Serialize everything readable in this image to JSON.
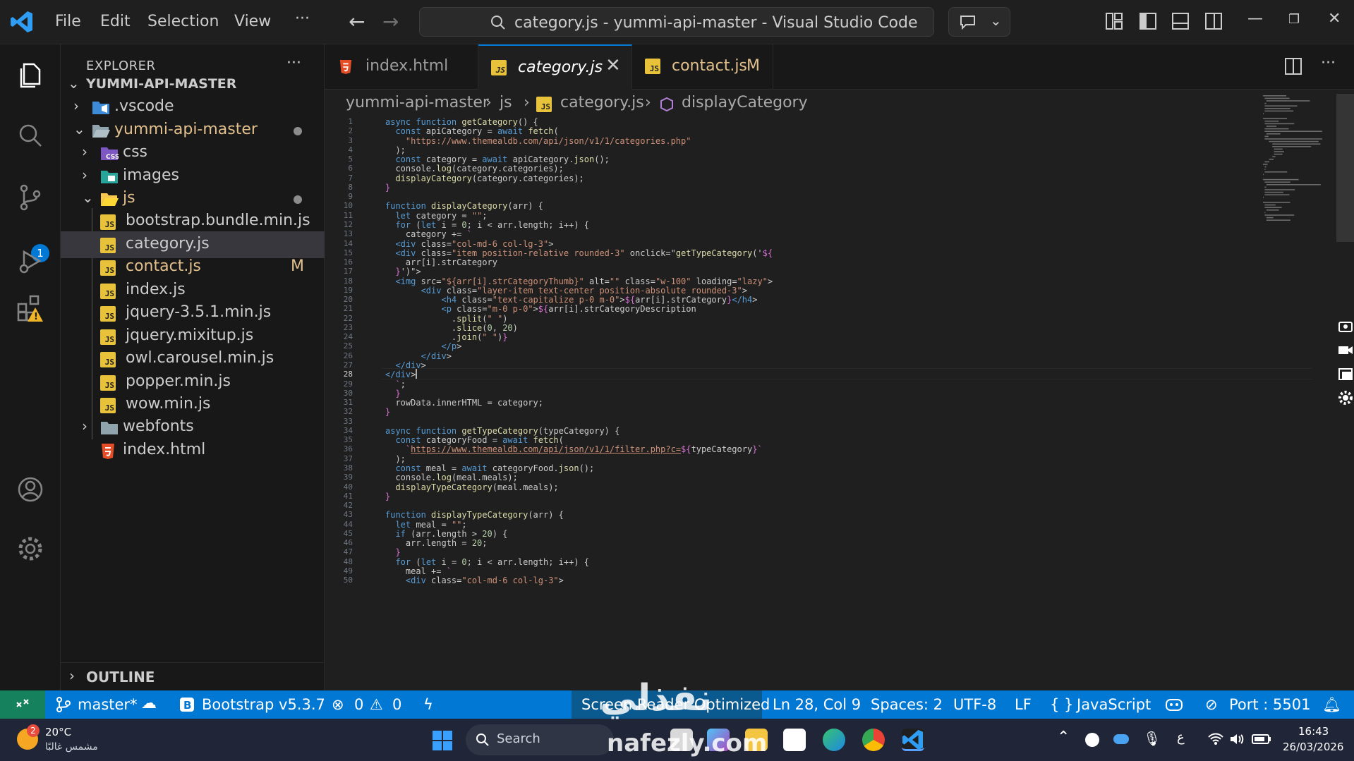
{
  "titlebar": {
    "menu": [
      "File",
      "Edit",
      "Selection",
      "View",
      "···"
    ],
    "title": "category.js - yummi-api-master - Visual Studio Code"
  },
  "explorer": {
    "header": "EXPLORER",
    "more": "···",
    "root": "YUMMI-API-MASTER",
    "items": [
      {
        "label": ".vscode"
      },
      {
        "label": "yummi-api-master"
      },
      {
        "label": "css"
      },
      {
        "label": "images"
      },
      {
        "label": "js"
      },
      {
        "label": "bootstrap.bundle.min.js"
      },
      {
        "label": "category.js"
      },
      {
        "label": "contact.js",
        "status": "M"
      },
      {
        "label": "index.js"
      },
      {
        "label": "jquery-3.5.1.min.js"
      },
      {
        "label": "jquery.mixitup.js"
      },
      {
        "label": "owl.carousel.min.js"
      },
      {
        "label": "popper.min.js"
      },
      {
        "label": "wow.min.js"
      },
      {
        "label": "webfonts"
      },
      {
        "label": "index.html"
      }
    ],
    "outline": "OUTLINE"
  },
  "activitybar": {
    "source_control_badge": "1"
  },
  "tabs": [
    {
      "label": "index.html"
    },
    {
      "label": "category.js"
    },
    {
      "label": "contact.js",
      "status": "M"
    }
  ],
  "breadcrumbs": [
    "yummi-api-master",
    "js",
    "category.js",
    "displayCategory"
  ],
  "code": {
    "current_line": 28,
    "lines": [
      "async function getCategory() {",
      "  const apiCategory = await fetch(",
      "    \"https://www.themealdb.com/api/json/v1/1/categories.php\"",
      "  );",
      "  const category = await apiCategory.json();",
      "  console.log(category.categories);",
      "  displayCategory(category.categories);",
      "}",
      "",
      "function displayCategory(arr) {",
      "  let category = \"\";",
      "  for (let i = 0; i < arr.length; i++) {",
      "    category += `",
      "  <div class=\"col-md-6 col-lg-3\">",
      "  <div class=\"item position-relative rounded-3\" onclick=\"getTypeCategory('${",
      "    arr[i].strCategory",
      "  }')\">",
      "  <img src=\"${arr[i].strCategoryThumb}\" alt=\"\" class=\"w-100\" loading=\"lazy\">",
      "       <div class=\"layer-item text-center position-absolute rounded-3\">",
      "           <h4 class=\"text-capitalize p-0 m-0\">${arr[i].strCategory}</h4>",
      "           <p class=\"m-0 p-0\">${arr[i].strCategoryDescription",
      "             .split(\" \")",
      "             .slice(0, 20)",
      "             .join(\" \")}",
      "           </p>",
      "       </div>",
      "  </div>",
      "</div>",
      "  `;",
      "  }",
      "  rowData.innerHTML = category;",
      "}",
      "",
      "async function getTypeCategory(typeCategory) {",
      "  const categoryFood = await fetch(",
      "    `https://www.themealdb.com/api/json/v1/1/filter.php?c=${typeCategory}`",
      "  );",
      "  const meal = await categoryFood.json();",
      "  console.log(meal.meals);",
      "  displayTypeCategory(meal.meals);",
      "}",
      "",
      "function displayTypeCategory(arr) {",
      "  let meal = \"\";",
      "  if (arr.length > 20) {",
      "    arr.length = 20;",
      "  }",
      "  for (let i = 0; i < arr.length; i++) {",
      "    meal += `",
      "    <div class=\"col-md-6 col-lg-3\">"
    ]
  },
  "statusbar": {
    "branch": "master*",
    "bootstrap": "Bootstrap v5.3.7",
    "errors": "0",
    "warnings": "0",
    "screen_reader": "Screen Reader Optimized",
    "position": "Ln 28, Col 9",
    "spaces": "Spaces: 2",
    "encoding": "UTF-8",
    "eol": "LF",
    "language": "JavaScript",
    "port": "Port : 5501"
  },
  "taskbar": {
    "weather_temp": "20°C",
    "weather_desc": "مشمس غالبًا",
    "search": "Search",
    "lang": "ع",
    "time": "16:43",
    "date": "26/03/2026",
    "weather_badge": "2"
  },
  "watermark": {
    "arabic": "نفذلي",
    "site": "nafezly.com"
  },
  "colors": {
    "accent": "#0078d4",
    "status_bar": "#0078d4",
    "modified": "#e2c08d",
    "js_icon": "#e8c23a"
  }
}
